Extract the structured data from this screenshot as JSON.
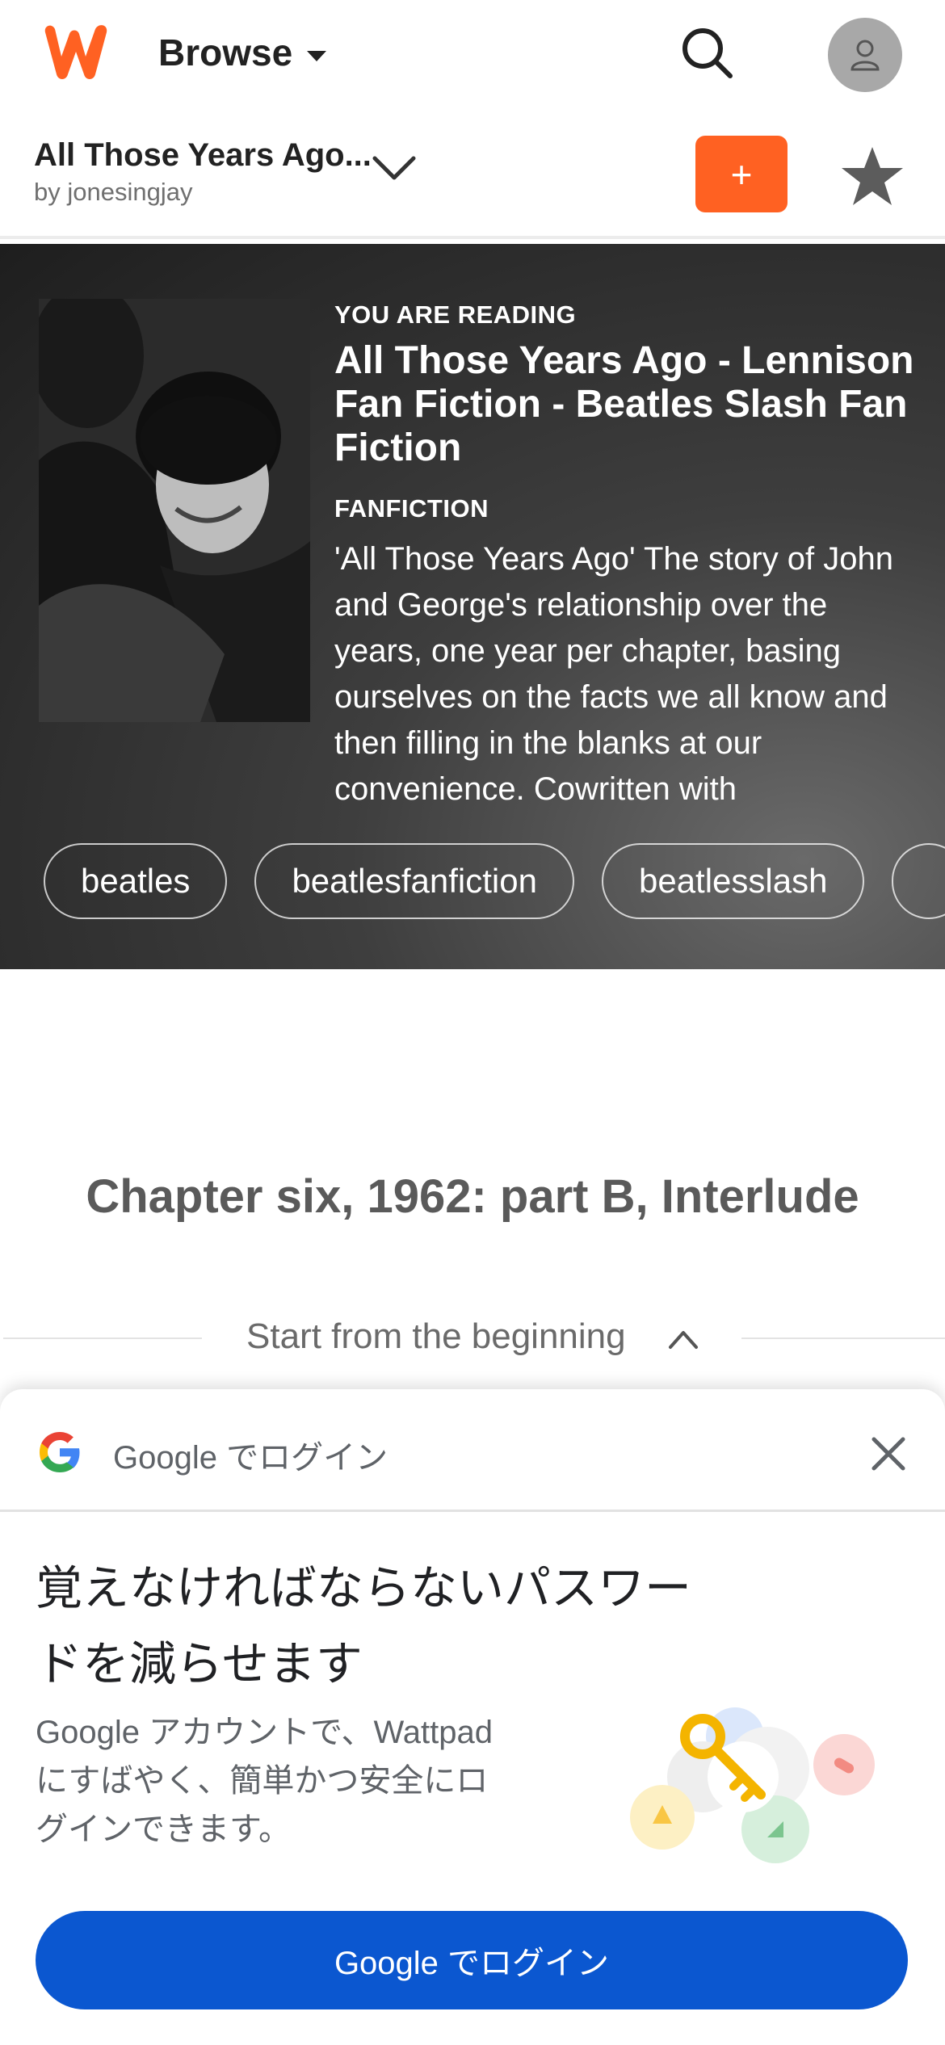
{
  "header": {
    "browse_label": "Browse"
  },
  "story_bar": {
    "title": "All Those Years Ago...",
    "author": "by jonesingjay",
    "add_label": "+"
  },
  "hero": {
    "reading_label": "YOU ARE READING",
    "title": "All Those Years Ago - Lennison Fan Fiction - Beatles Slash Fan Fiction",
    "category": "FANFICTION",
    "description": "'All Those Years Ago' The story of John and George's relationship over the years, one year per chapter, basing ourselves on the facts we all know and then filling in the blanks at our convenience. Cowritten with",
    "tags": [
      "beatles",
      "beatlesfanfiction",
      "beatlesslash",
      ""
    ]
  },
  "chapter": {
    "title": "Chapter six, 1962: part B, Interlude",
    "start_label": "Start from the beginning"
  },
  "google_sheet": {
    "header_text": "Google でログイン",
    "heading": "覚えなければならないパスワードを減らせます",
    "body": "Google アカウントで、Wattpad にすばやく、簡単かつ安全にログインできます。",
    "button_label": "Google でログイン"
  },
  "colors": {
    "brand_orange": "#ff6122",
    "google_blue": "#0b57d0"
  }
}
